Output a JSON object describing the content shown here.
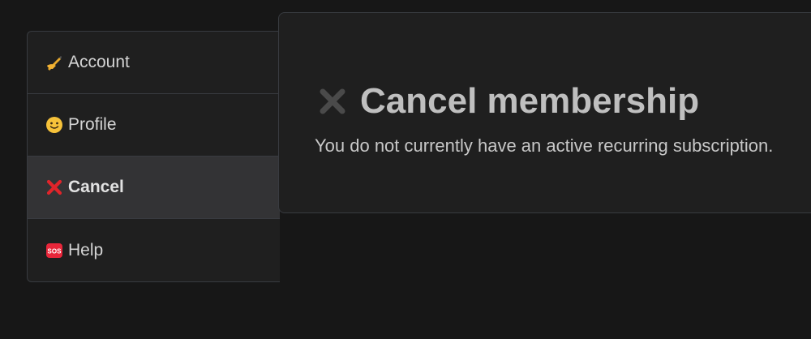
{
  "sidebar": {
    "items": [
      {
        "label": "Account",
        "icon": "writing-hand-icon",
        "active": false
      },
      {
        "label": "Profile",
        "icon": "smiley-face-icon",
        "active": false
      },
      {
        "label": "Cancel",
        "icon": "red-cross-icon",
        "active": true
      },
      {
        "label": "Help",
        "icon": "sos-icon",
        "active": false
      }
    ]
  },
  "panel": {
    "title": "Cancel membership",
    "title_icon": "cross-icon",
    "message": "You do not currently have an active recurring subscription."
  },
  "colors": {
    "background": "#171717",
    "card": "#1f1f1f",
    "active_item": "#333335",
    "border": "#383b40",
    "accent_red": "#e0242a"
  }
}
